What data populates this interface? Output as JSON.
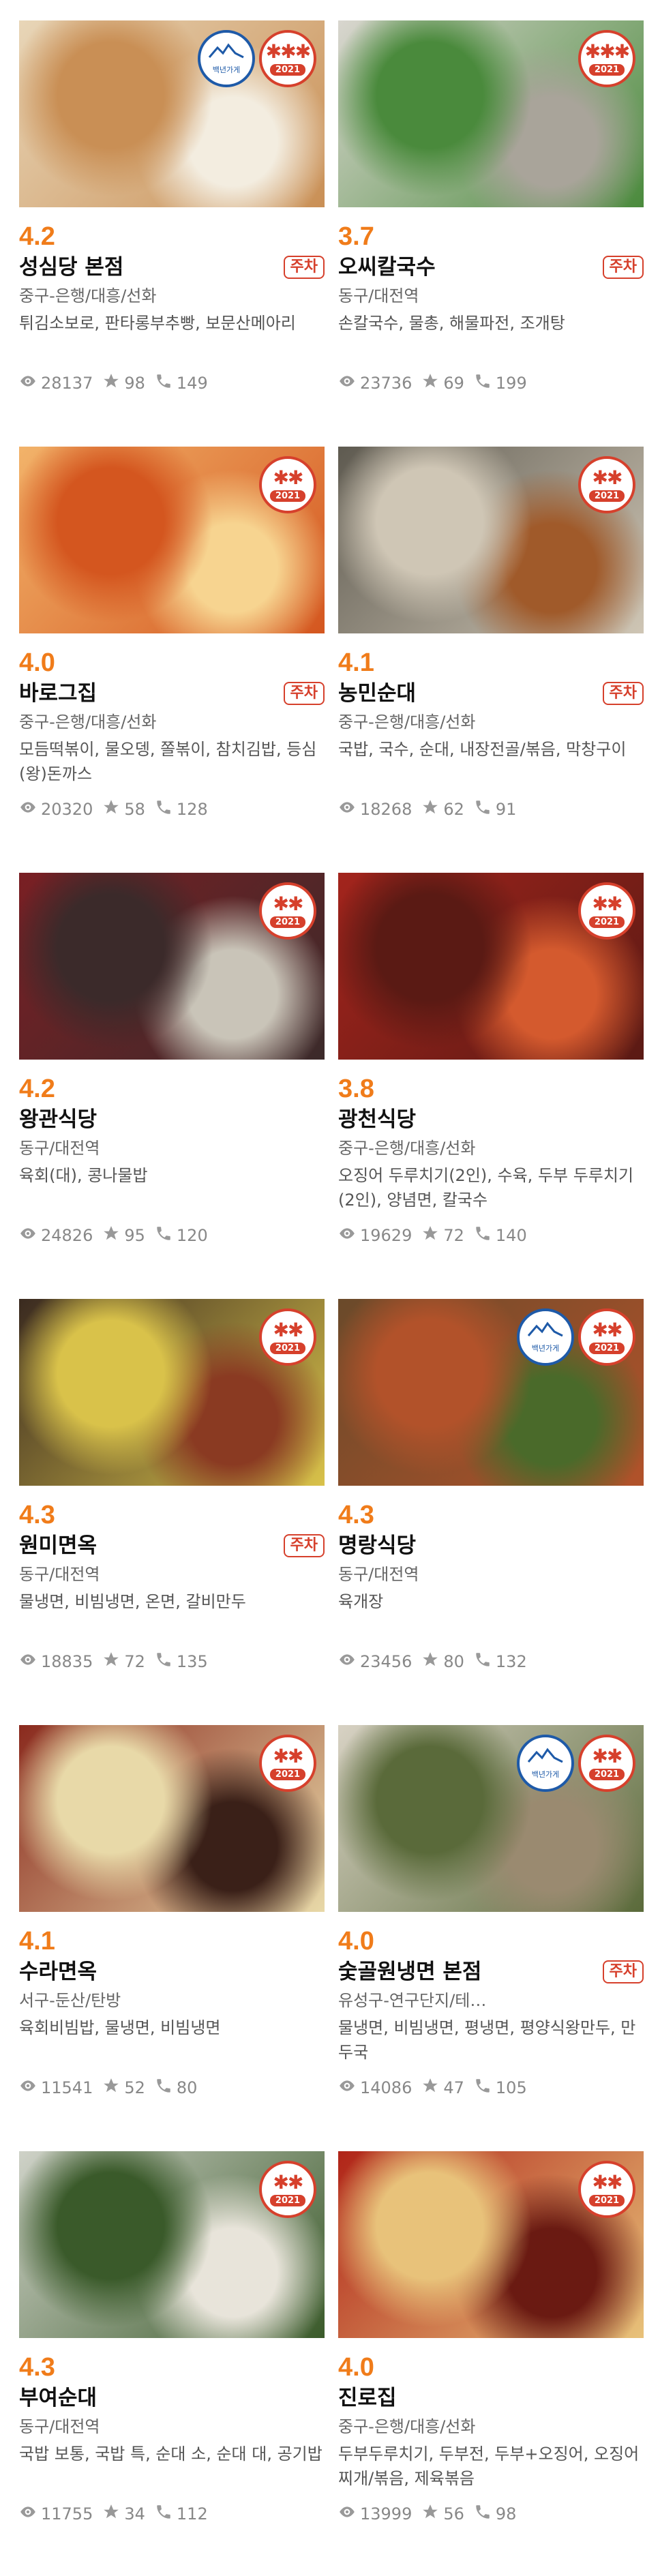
{
  "cards": [
    {
      "rating": "4.2",
      "name": "성심당 본점",
      "parking": "주차",
      "location": "중구-은행/대흥/선화",
      "menu": "튀김소보로, 판타롱부추빵, 보문산메아리",
      "views": "28137",
      "stars": "98",
      "calls": "149",
      "badge_stars": "✱✱✱",
      "badge_year": "2021",
      "wave_badge": true,
      "wave_text": "백년가게",
      "img_colors": [
        "#e8d6b8",
        "#c98f55",
        "#f3ede0"
      ]
    },
    {
      "rating": "3.7",
      "name": "오씨칼국수",
      "parking": "주차",
      "location": "동구/대전역",
      "menu": "손칼국수, 물총, 해물파전, 조개탕",
      "views": "23736",
      "stars": "69",
      "calls": "199",
      "badge_stars": "✱✱✱",
      "badge_year": "2021",
      "wave_badge": false,
      "img_colors": [
        "#d9d6cf",
        "#4a8a3c",
        "#a9a49a"
      ]
    },
    {
      "rating": "4.0",
      "name": "바로그집",
      "parking": "주차",
      "location": "중구-은행/대흥/선화",
      "menu": "모듬떡볶이, 물오뎅, 쫄볶이, 참치김밥, 등심(왕)돈까스",
      "views": "20320",
      "stars": "58",
      "calls": "128",
      "badge_stars": "✱✱",
      "badge_year": "2021",
      "wave_badge": false,
      "img_colors": [
        "#f2b36a",
        "#d4561f",
        "#f7d490"
      ]
    },
    {
      "rating": "4.1",
      "name": "농민순대",
      "parking": "주차",
      "location": "중구-은행/대흥/선화",
      "menu": "국밥, 국수, 순대, 내장전골/볶음, 막창구이",
      "views": "18268",
      "stars": "62",
      "calls": "91",
      "badge_stars": "✱✱",
      "badge_year": "2021",
      "wave_badge": false,
      "img_colors": [
        "#5e5a50",
        "#cfc6b5",
        "#a05a2a"
      ]
    },
    {
      "rating": "4.2",
      "name": "왕관식당",
      "parking": "",
      "location": "동구/대전역",
      "menu": "육회(대), 콩나물밥",
      "views": "24826",
      "stars": "95",
      "calls": "120",
      "badge_stars": "✱✱",
      "badge_year": "2021",
      "wave_badge": false,
      "img_colors": [
        "#7a1f24",
        "#3b2a2a",
        "#c9c4b8"
      ]
    },
    {
      "rating": "3.8",
      "name": "광천식당",
      "parking": "",
      "location": "중구-은행/대흥/선화",
      "menu": "오징어 두루치기(2인), 수육, 두부 두루치기(2인), 양념면, 칼국수",
      "views": "19629",
      "stars": "72",
      "calls": "140",
      "badge_stars": "✱✱",
      "badge_year": "2021",
      "wave_badge": false,
      "img_colors": [
        "#a3241c",
        "#5a1a14",
        "#d45a2e"
      ]
    },
    {
      "rating": "4.3",
      "name": "원미면옥",
      "parking": "주차",
      "location": "동구/대전역",
      "menu": "물냉면, 비빔냉면, 온면, 갈비만두",
      "views": "18835",
      "stars": "72",
      "calls": "135",
      "badge_stars": "✱✱",
      "badge_year": "2021",
      "wave_badge": false,
      "img_colors": [
        "#3a2a20",
        "#d9c24a",
        "#8a3a22"
      ]
    },
    {
      "rating": "4.3",
      "name": "명랑식당",
      "parking": "",
      "location": "동구/대전역",
      "menu": "육개장",
      "views": "23456",
      "stars": "80",
      "calls": "132",
      "badge_stars": "✱✱",
      "badge_year": "2021",
      "wave_badge": true,
      "wave_text": "백년가게",
      "img_colors": [
        "#6a4a2a",
        "#b2522a",
        "#4a6a2a"
      ]
    },
    {
      "rating": "4.1",
      "name": "수라면옥",
      "parking": "",
      "location": "서구-둔산/탄방",
      "menu": "육회비빔밥, 물냉면, 비빔냉면",
      "views": "11541",
      "stars": "52",
      "calls": "80",
      "badge_stars": "✱✱",
      "badge_year": "2021",
      "wave_badge": false,
      "img_colors": [
        "#8a2a1e",
        "#e8d9a8",
        "#3a2018"
      ]
    },
    {
      "rating": "4.0",
      "name": "숯골원냉면 본점",
      "parking": "주차",
      "location": "유성구-연구단지/테…",
      "menu": "물냉면, 비빔냉면, 평냉면, 평양식왕만두, 만두국",
      "views": "14086",
      "stars": "47",
      "calls": "105",
      "badge_stars": "✱✱",
      "badge_year": "2021",
      "wave_badge": true,
      "wave_text": "백년가게",
      "img_colors": [
        "#d8d2c4",
        "#5a6a3a",
        "#9a8a70"
      ]
    },
    {
      "rating": "4.3",
      "name": "부여순대",
      "parking": "",
      "location": "동구/대전역",
      "menu": "국밥 보통, 국밥 특, 순대 소, 순대 대, 공기밥",
      "views": "11755",
      "stars": "34",
      "calls": "112",
      "badge_stars": "✱✱",
      "badge_year": "2021",
      "wave_badge": false,
      "img_colors": [
        "#cfd2c8",
        "#3a5a2a",
        "#e8e4da"
      ]
    },
    {
      "rating": "4.0",
      "name": "진로집",
      "parking": "",
      "location": "중구-은행/대흥/선화",
      "menu": "두부두루치기, 두부전, 두부+오징어, 오징어찌개/볶음, 제육볶음",
      "views": "13999",
      "stars": "56",
      "calls": "98",
      "badge_stars": "✱✱",
      "badge_year": "2021",
      "wave_badge": false,
      "img_colors": [
        "#b02418",
        "#e8c27a",
        "#6a1a12"
      ]
    }
  ]
}
